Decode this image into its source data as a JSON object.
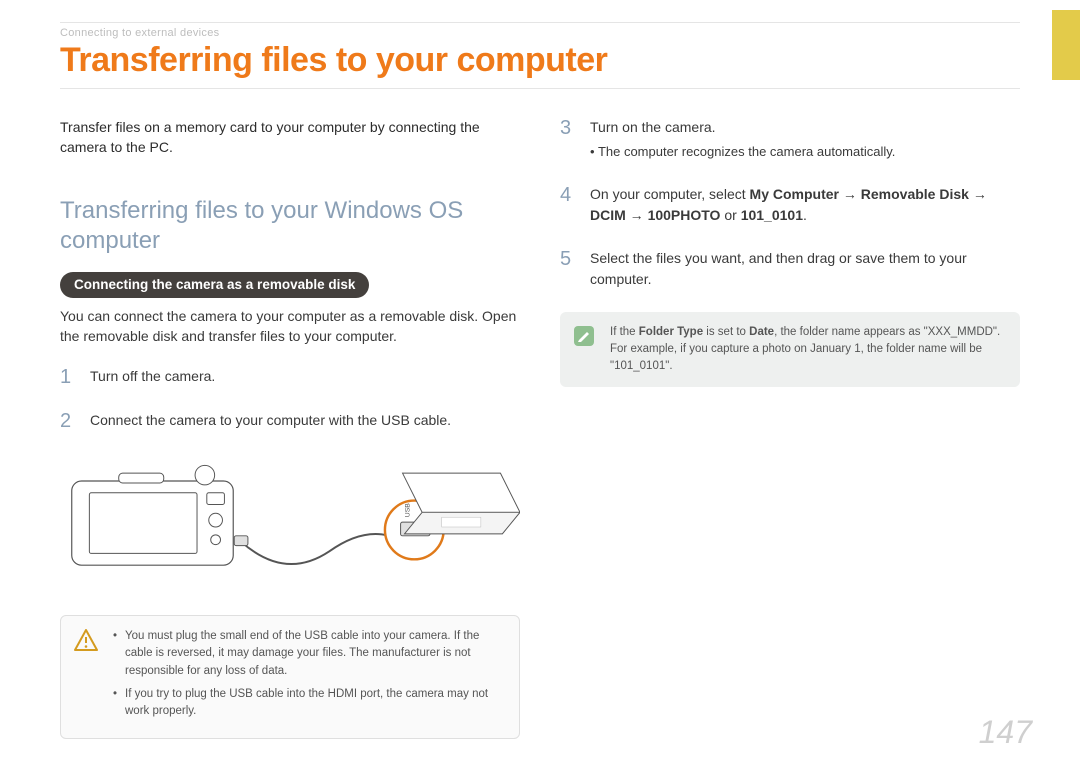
{
  "chapter": "Connecting to external devices",
  "title": "Transferring files to your computer",
  "intro": "Transfer files on a memory card to your computer by connecting the camera to the PC.",
  "subhead": "Transferring files to your Windows OS computer",
  "pill": "Connecting the camera as a removable disk",
  "pill_desc": "You can connect the camera to your computer as a removable disk. Open the removable disk and transfer files to your computer.",
  "steps": {
    "s1": {
      "n": "1",
      "t": "Turn off the camera."
    },
    "s2": {
      "n": "2",
      "t": "Connect the camera to your computer with the USB cable."
    },
    "s3": {
      "n": "3",
      "t": "Turn on the camera.",
      "sub": "The computer recognizes the camera automatically."
    },
    "s4": {
      "n": "4",
      "pre": "On your computer, select ",
      "b1": "My Computer",
      "arrow": " → ",
      "b2": "Removable Disk",
      "b3": "DCIM",
      "b4": "100PHOTO",
      "or": " or ",
      "b5": "101_0101",
      "dot": "."
    },
    "s5": {
      "n": "5",
      "t": "Select the files you want, and then drag or save them to your computer."
    }
  },
  "warn": {
    "w1": "You must plug the small end of the USB cable into your camera. If the cable is reversed, it may damage your files. The manufacturer is not responsible for any loss of data.",
    "w2": "If you try to plug the USB cable into the HDMI port, the camera may not work properly."
  },
  "note": {
    "pre": "If the ",
    "b1": "Folder Type",
    "mid": " is set to ",
    "b2": "Date",
    "post": ", the folder name appears as \"XXX_MMDD\". For example, if you capture a photo on January 1, the folder name will be \"101_0101\"."
  },
  "page_number": "147"
}
